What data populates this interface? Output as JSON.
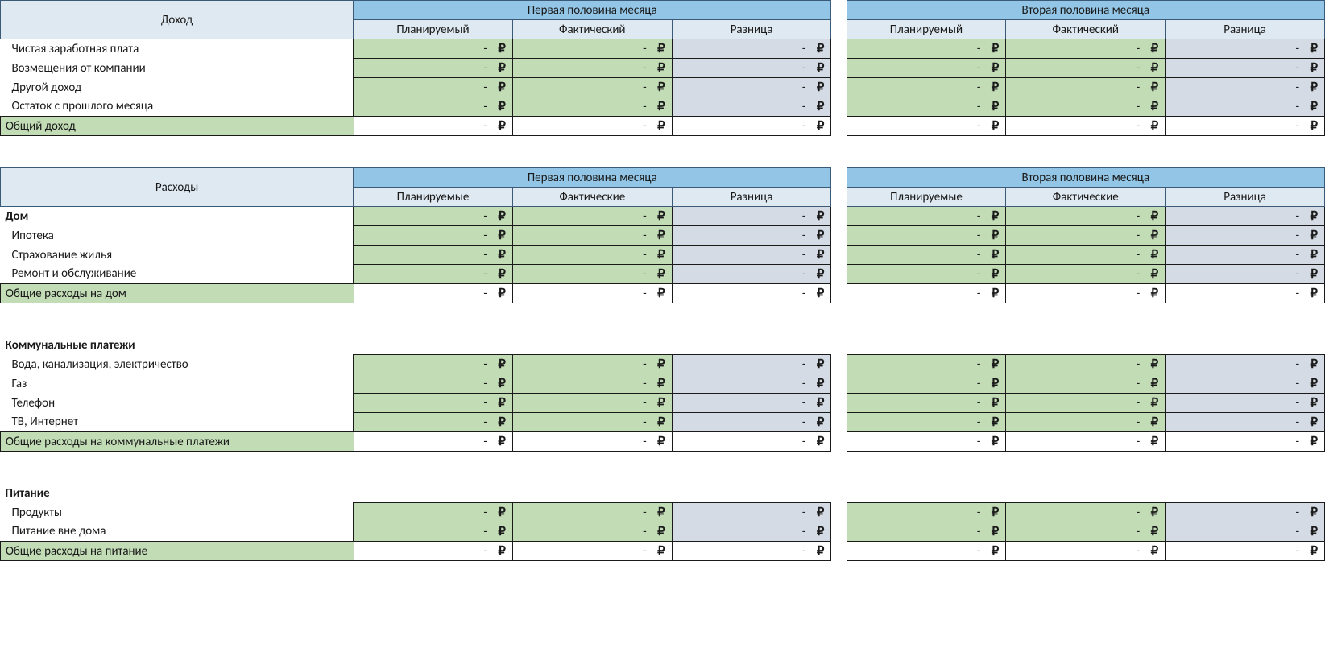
{
  "currency": "₽",
  "dash": "-",
  "halves": {
    "first": {
      "title": "Первая половина месяца"
    },
    "second": {
      "title": "Вторая половина месяца"
    }
  },
  "income": {
    "label": "Доход",
    "cols": {
      "plan": "Планируемый",
      "fact": "Фактический",
      "diff": "Разница"
    },
    "rows": [
      {
        "label": "Чистая заработная плата"
      },
      {
        "label": "Возмещения от компании"
      },
      {
        "label": "Другой доход"
      },
      {
        "label": "Остаток с прошлого месяца"
      }
    ],
    "total_label": "Общий доход"
  },
  "expenses": {
    "label": "Расходы",
    "cols": {
      "plan": "Планируемые",
      "fact": "Фактические",
      "diff": "Разница"
    },
    "groups": [
      {
        "name": "Дом",
        "show_name_inline": true,
        "rows": [
          {
            "label": "Ипотека"
          },
          {
            "label": "Страхование жилья"
          },
          {
            "label": "Ремонт и обслуживание"
          }
        ],
        "total_label": "Общие расходы на дом"
      },
      {
        "name": "Коммунальные платежи",
        "show_name_inline": false,
        "rows": [
          {
            "label": "Вода, канализация, электричество"
          },
          {
            "label": "Газ"
          },
          {
            "label": "Телефон"
          },
          {
            "label": "ТВ, Интернет"
          }
        ],
        "total_label": "Общие расходы на коммунальные платежи"
      },
      {
        "name": "Питание",
        "show_name_inline": false,
        "rows": [
          {
            "label": "Продукты"
          },
          {
            "label": "Питание вне дома"
          }
        ],
        "total_label": "Общие расходы на питание"
      }
    ]
  }
}
